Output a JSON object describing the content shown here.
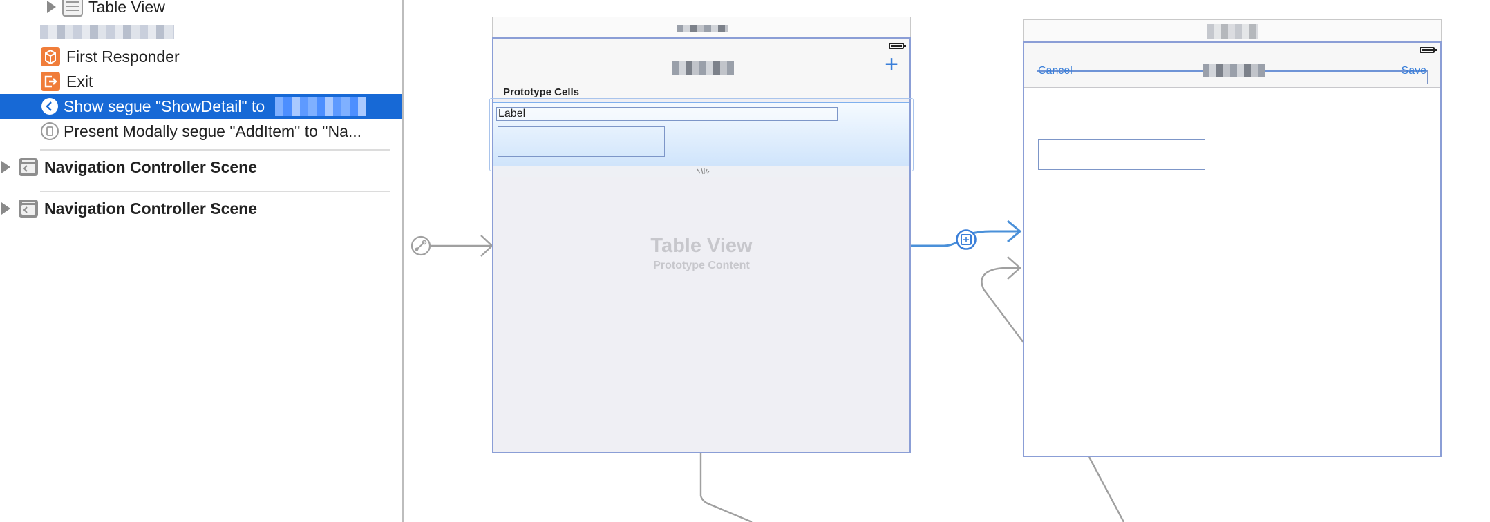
{
  "outline": {
    "items": [
      {
        "label": "Table View"
      },
      {
        "label": "First Responder"
      },
      {
        "label": "Exit"
      },
      {
        "label": "Show segue \"ShowDetail\" to"
      },
      {
        "label": "Present Modally segue \"AddItem\" to \"Na..."
      }
    ],
    "scenes": [
      {
        "label": "Navigation Controller Scene"
      },
      {
        "label": "Navigation Controller Scene"
      }
    ]
  },
  "table_scene": {
    "nav_add_symbol": "+",
    "section_header": "Prototype Cells",
    "cell_label": "Label",
    "placeholder_title": "Table View",
    "placeholder_subtitle": "Prototype Content"
  },
  "detail_scene": {
    "cancel": "Cancel",
    "save": "Save"
  },
  "colors": {
    "selection": "#1769d6",
    "accent": "#3a7fd9",
    "segue_selected": "#4a90d9",
    "segue": "#a0a0a0",
    "frame_border": "#8b9ed6",
    "orange_icon": "#f07d3a"
  },
  "icons": [
    "disclosure-triangle-icon",
    "table-view-icon",
    "first-responder-icon",
    "exit-icon",
    "show-segue-icon",
    "modal-segue-icon",
    "scene-icon",
    "battery-icon",
    "add-icon",
    "relationship-segue-icon",
    "segue-badge-icon",
    "resize-handle-icon"
  ]
}
